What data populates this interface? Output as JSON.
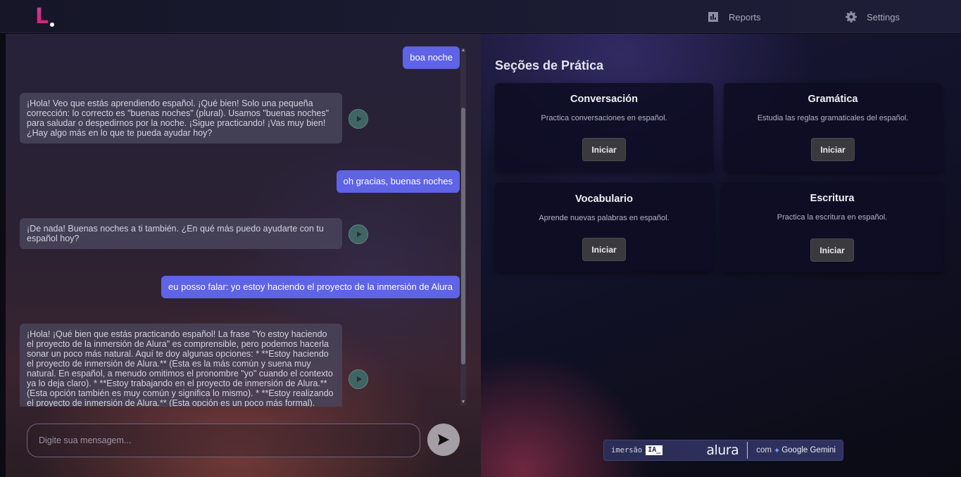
{
  "header": {
    "logo_letter": "L",
    "nav": [
      {
        "label": "Reports",
        "icon": "bar-chart-icon"
      },
      {
        "label": "Settings",
        "icon": "gear-icon"
      }
    ]
  },
  "chat": {
    "messages": [
      {
        "role": "user",
        "text": "boa noche"
      },
      {
        "role": "bot",
        "text": "¡Hola! Veo que estás aprendiendo español. ¡Qué bien! Solo una pequeña corrección: lo correcto es \"buenas noches\" (plural). Usamos \"buenas noches\" para saludar o despedirnos por la noche. ¡Sigue practicando! ¡Vas muy bien! ¿Hay algo más en lo que te pueda ayudar hoy?"
      },
      {
        "role": "user",
        "text": "oh gracias, buenas noches"
      },
      {
        "role": "bot",
        "text": "¡De nada! Buenas noches a ti también. ¿En qué más puedo ayudarte con tu español hoy?"
      },
      {
        "role": "user",
        "text": "eu posso falar: yo estoy haciendo el proyecto de la inmersión de Alura"
      },
      {
        "role": "bot",
        "text": "¡Hola! ¡Qué bien que estás practicando español! La frase \"Yo estoy haciendo el proyecto de la inmersión de Alura\" es comprensible, pero podemos hacerla sonar un poco más natural. Aquí te doy algunas opciones: * **Estoy haciendo el proyecto de inmersión de Alura.** (Esta es la más común y suena muy natural. En español, a menudo omitimos el pronombre \"yo\" cuando el contexto ya lo deja claro). * **Estoy trabajando en el proyecto de inmersión de Alura.** (Esta opción también es muy común y significa lo mismo). * **Estoy realizando el proyecto de inmersión de Alura.** (Esta opción es un poco más formal). ¡Sigue"
      }
    ],
    "input_placeholder": "Digite sua mensagem..."
  },
  "practice": {
    "title": "Seções de Prática",
    "cards": [
      {
        "title": "Conversación",
        "description": "Practica conversaciones en español.",
        "button": "Iniciar"
      },
      {
        "title": "Gramática",
        "description": "Estudia las reglas gramaticales del español.",
        "button": "Iniciar"
      },
      {
        "title": "Vocabulario",
        "description": "Aprende nuevas palabras en español.",
        "button": "Iniciar"
      },
      {
        "title": "Escritura",
        "description": "Practica la escritura en español.",
        "button": "Iniciar"
      }
    ]
  },
  "banner": {
    "imersao": "imersão",
    "ia": "IA_",
    "alura": "alura",
    "com": "com",
    "gemini": "Google Gemini"
  },
  "colors": {
    "user_bubble": "#5f63e6",
    "bot_bubble": "#49465c",
    "card_bg": "#0e0d23",
    "logo": "#d3236a"
  }
}
